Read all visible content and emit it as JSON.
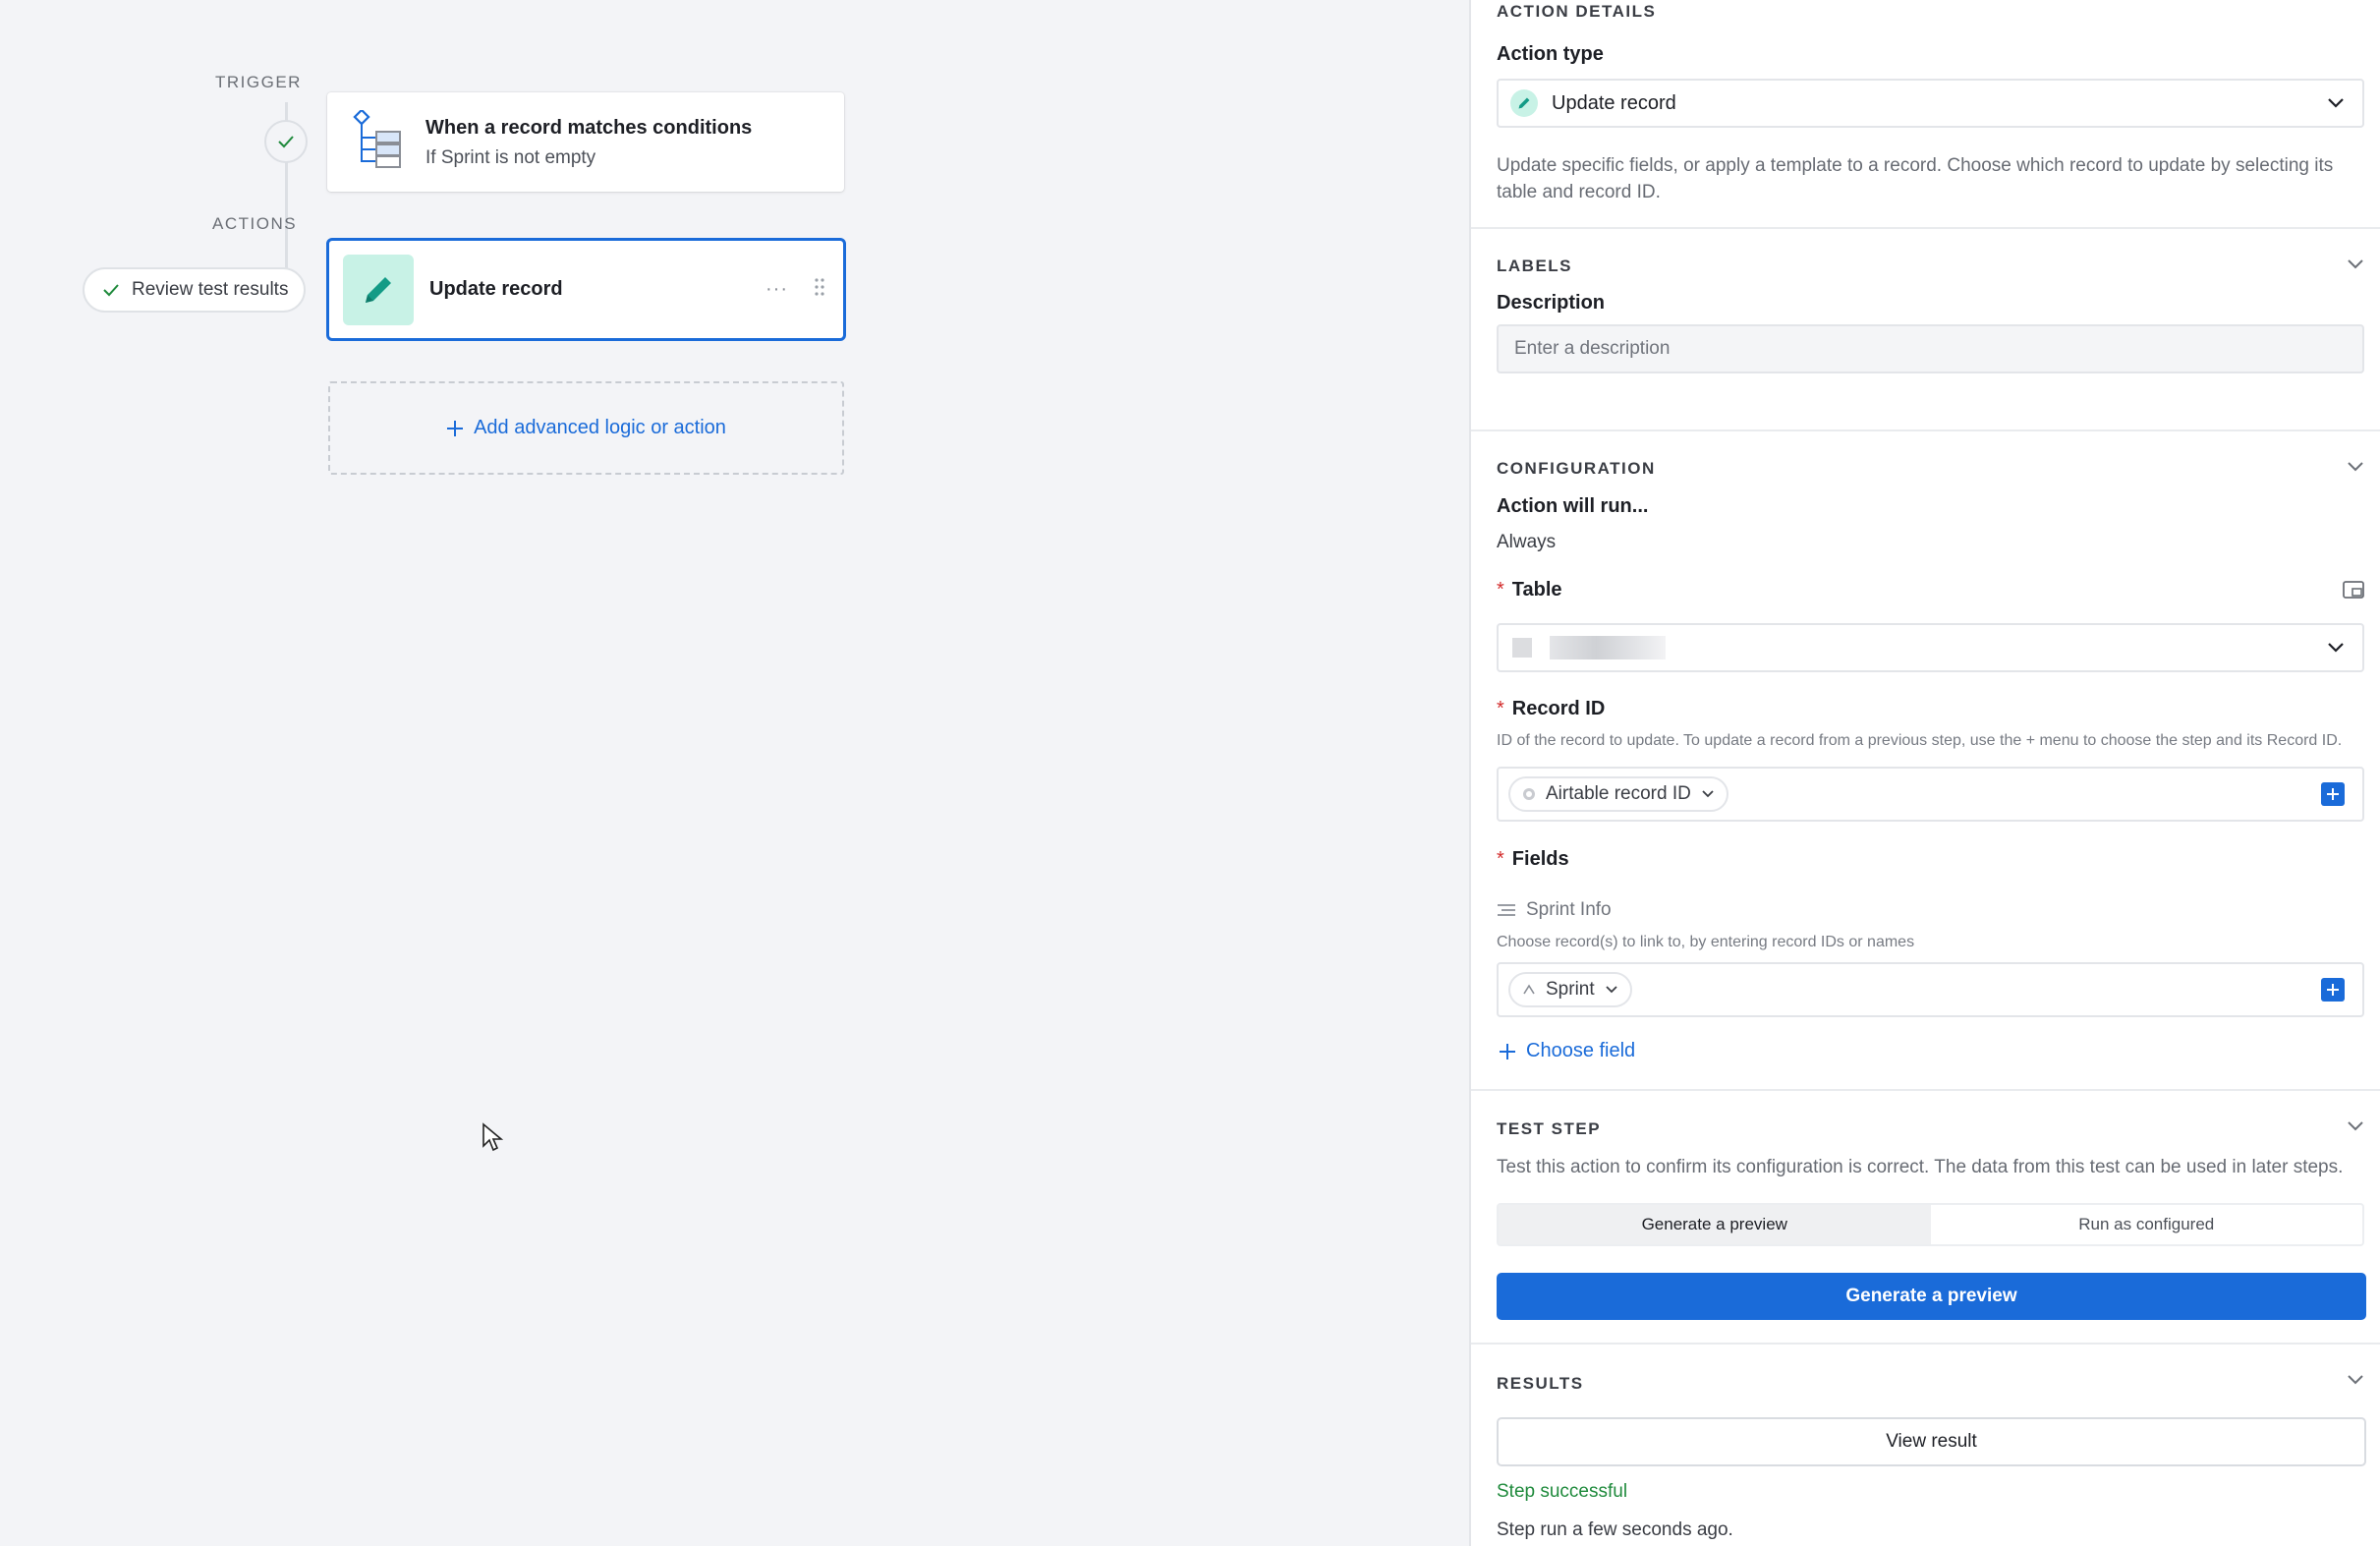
{
  "canvas": {
    "trigger_label": "TRIGGER",
    "actions_label": "ACTIONS",
    "trigger_card": {
      "title": "When a record matches conditions",
      "subtitle": "If Sprint is not empty",
      "icon": "conditions-tree-icon"
    },
    "review_pill": {
      "label": "Review test results",
      "icon": "check-icon"
    },
    "action_card": {
      "title": "Update record",
      "icon": "pencil-icon",
      "more_icon": "ellipsis-icon",
      "drag_icon": "drag-handle-icon"
    },
    "add_action": {
      "label": "Add advanced logic or action",
      "icon": "plus-icon"
    }
  },
  "panel": {
    "action_details": {
      "heading": "ACTION DETAILS",
      "action_type_label": "Action type",
      "action_type_value": "Update record",
      "description": "Update specific fields, or apply a template to a record. Choose which record to update by selecting its table and record ID."
    },
    "labels": {
      "heading": "LABELS",
      "description_label": "Description",
      "description_placeholder": "Enter a description"
    },
    "configuration": {
      "heading": "CONFIGURATION",
      "run_label": "Action will run...",
      "run_value": "Always",
      "table_label": "Table",
      "record_id_label": "Record ID",
      "record_id_help": "ID of the record to update. To update a record from a previous step, use the + menu to choose the step and its Record ID.",
      "record_id_token": "Airtable record ID",
      "fields_label": "Fields",
      "field_name": "Sprint Info",
      "field_help": "Choose record(s) to link to, by entering record IDs or names",
      "field_token": "Sprint",
      "choose_field": "Choose field"
    },
    "test_step": {
      "heading": "TEST STEP",
      "description": "Test this action to confirm its configuration is correct. The data from this test can be used in later steps.",
      "tab_preview": "Generate a preview",
      "tab_run": "Run as configured",
      "button": "Generate a preview"
    },
    "results": {
      "heading": "RESULTS",
      "view_button": "View result",
      "status": "Step successful",
      "time": "Step run a few seconds ago."
    }
  },
  "colors": {
    "accent": "#1a6bd9",
    "success": "#1f8a3c",
    "required": "#d32c2c",
    "edit_tile": "#c8f2e6"
  }
}
